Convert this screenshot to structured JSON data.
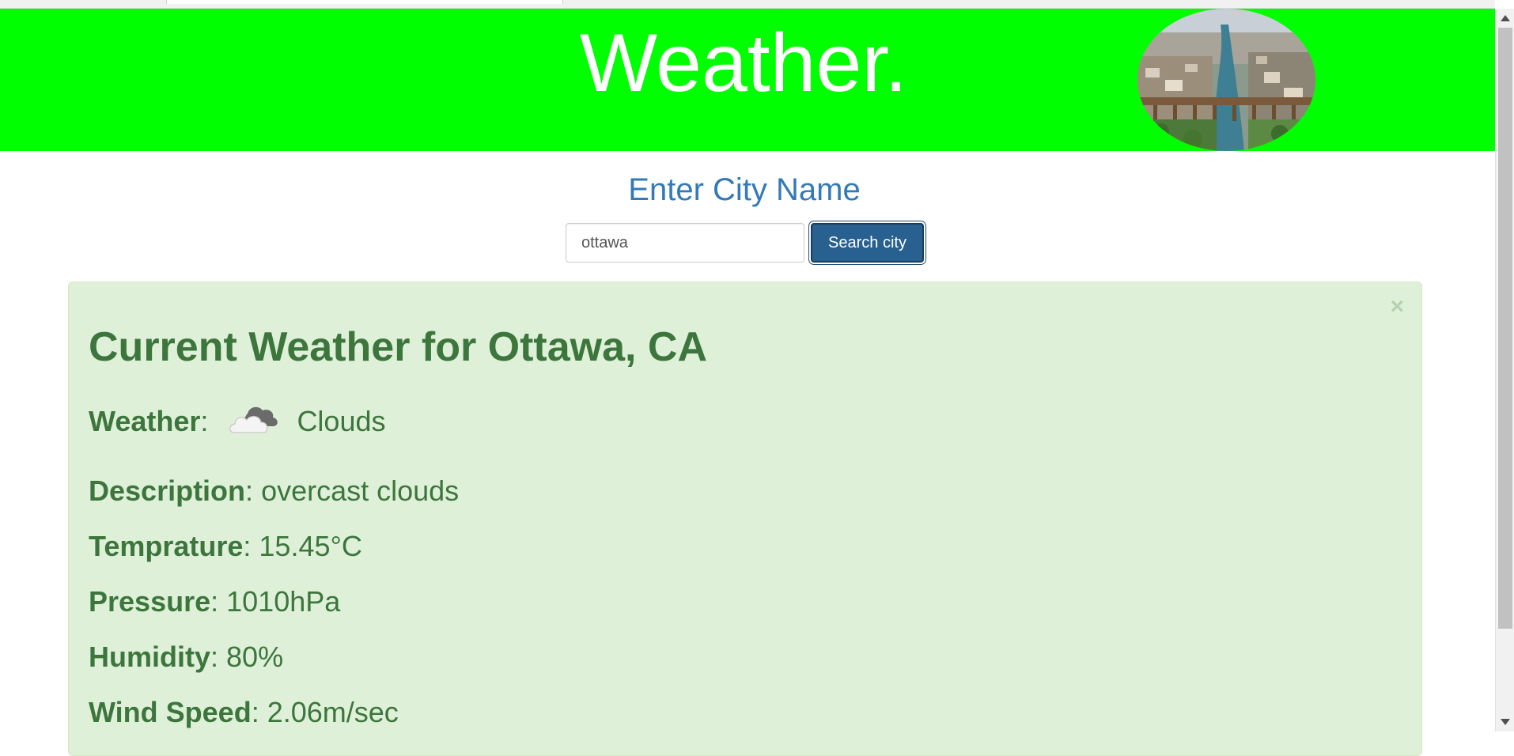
{
  "header": {
    "title": "Weather."
  },
  "search": {
    "heading": "Enter City Name",
    "input_value": "ottawa",
    "button_label": "Search city"
  },
  "result": {
    "title": "Current Weather for Ottawa, CA",
    "close_label": "×",
    "weather_label": "Weather",
    "weather_value": "Clouds",
    "weather_icon": "clouds-icon",
    "description_label": "Description",
    "description_value": "overcast clouds",
    "temperature_label": "Temprature",
    "temperature_value": "15.45°C",
    "pressure_label": "Pressure",
    "pressure_value": "1010hPa",
    "humidity_label": "Humidity",
    "humidity_value": "80%",
    "wind_label": "Wind Speed",
    "wind_value": "2.06m/sec"
  },
  "colors": {
    "header_bg": "#00ff00",
    "heading_blue": "#337ab7",
    "button_bg": "#286090",
    "alert_bg": "#dff0d8",
    "alert_text": "#3c763d"
  }
}
